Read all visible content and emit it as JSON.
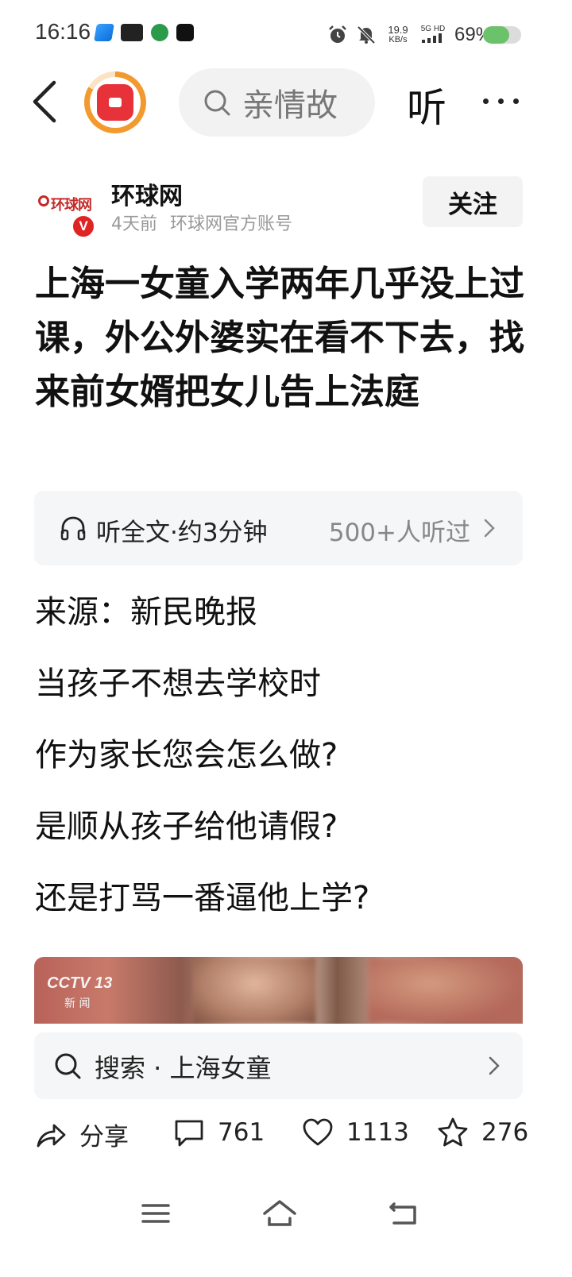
{
  "status_bar": {
    "time": "16:16",
    "net_speed_value": "19.9",
    "net_speed_unit": "KB/s",
    "network": "5G HD",
    "battery_pct": "69%",
    "battery_level": 0.69
  },
  "nav": {
    "search_text": "亲情故",
    "listen_label": "听"
  },
  "author": {
    "name": "环球网",
    "time_ago": "4天前",
    "account_type": "环球网官方账号",
    "logo_text": "环球网",
    "verified_mark": "V",
    "follow_label": "关注"
  },
  "article": {
    "title": "上海一女童入学两年几乎没上过课，外公外婆实在看不下去，找来前女婿把女儿告上法庭",
    "listen_bar": {
      "label": "听全文·约3分钟",
      "count": "500+人听过"
    },
    "paragraphs": [
      "来源：新民晚报",
      "当孩子不想去学校时",
      "作为家长您会怎么做?",
      "是顺从孩子给他请假?",
      "还是打骂一番逼他上学?"
    ],
    "video_logo": "CCTV 13",
    "video_logo_sub": "新 闻"
  },
  "search_suggestion": {
    "text": "搜索 · 上海女童"
  },
  "actions": {
    "share_label": "分享",
    "comment_count": "761",
    "like_count": "1113",
    "favorite_count": "276"
  },
  "colors": {
    "accent_red": "#e02424",
    "battery_green": "#6cc26a",
    "muted_gray": "#999999"
  }
}
